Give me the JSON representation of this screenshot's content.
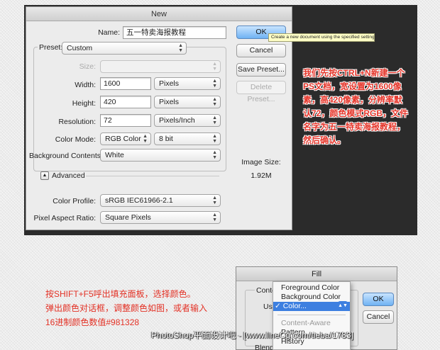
{
  "dialog": {
    "title": "New",
    "name_label": "Name:",
    "name_value": "五一特卖海报教程",
    "preset_label": "Preset:",
    "preset_value": "Custom",
    "size_label": "Size:",
    "width_label": "Width:",
    "width_value": "1600",
    "width_unit": "Pixels",
    "height_label": "Height:",
    "height_value": "420",
    "height_unit": "Pixels",
    "resolution_label": "Resolution:",
    "resolution_value": "72",
    "resolution_unit": "Pixels/Inch",
    "color_mode_label": "Color Mode:",
    "color_mode_value": "RGB Color",
    "bit_depth_value": "8 bit",
    "background_label": "Background Contents:",
    "background_value": "White",
    "advanced_label": "Advanced",
    "color_profile_label": "Color Profile:",
    "color_profile_value": "sRGB IEC61966-2.1",
    "pixel_aspect_label": "Pixel Aspect Ratio:",
    "pixel_aspect_value": "Square Pixels",
    "ok_label": "OK",
    "cancel_label": "Cancel",
    "save_preset_label": "Save Preset...",
    "delete_preset_label": "Delete Preset...",
    "image_size_label": "Image Size:",
    "image_size_value": "1.92M",
    "tooltip": "Create a new document using the specified settings"
  },
  "notes": {
    "top": "我们先按CTRL+N新建一个PS文档，宽设置为1600像素，高420像素，分辨率默认72，颜色模式RGB，文件名字为五一特卖海报教程，然后确认。",
    "bottom_lines": [
      "按SHIFT+F5呼出填充面板，选择颜色。",
      "弹出颜色对话框，调整颜色如图，或者输入",
      "16进制颜色数值#981328"
    ]
  },
  "fill": {
    "title": "Fill",
    "contents_label": "Conte",
    "use_label": "Use",
    "blend_label": "Blend",
    "ok_label": "OK",
    "cancel_label": "Cancel",
    "menu_items": [
      "Foreground Color",
      "Background Color",
      "✓ Color...",
      "Content-Aware",
      "Pattern",
      "History"
    ]
  },
  "watermark": "PhotoShop平面设计吧 - [www.lineCg.com/tieba/1783]",
  "colors": {
    "accent_note": "#e5352a",
    "selection": "#3d7fe0",
    "default_button": "#6fb2f3"
  }
}
